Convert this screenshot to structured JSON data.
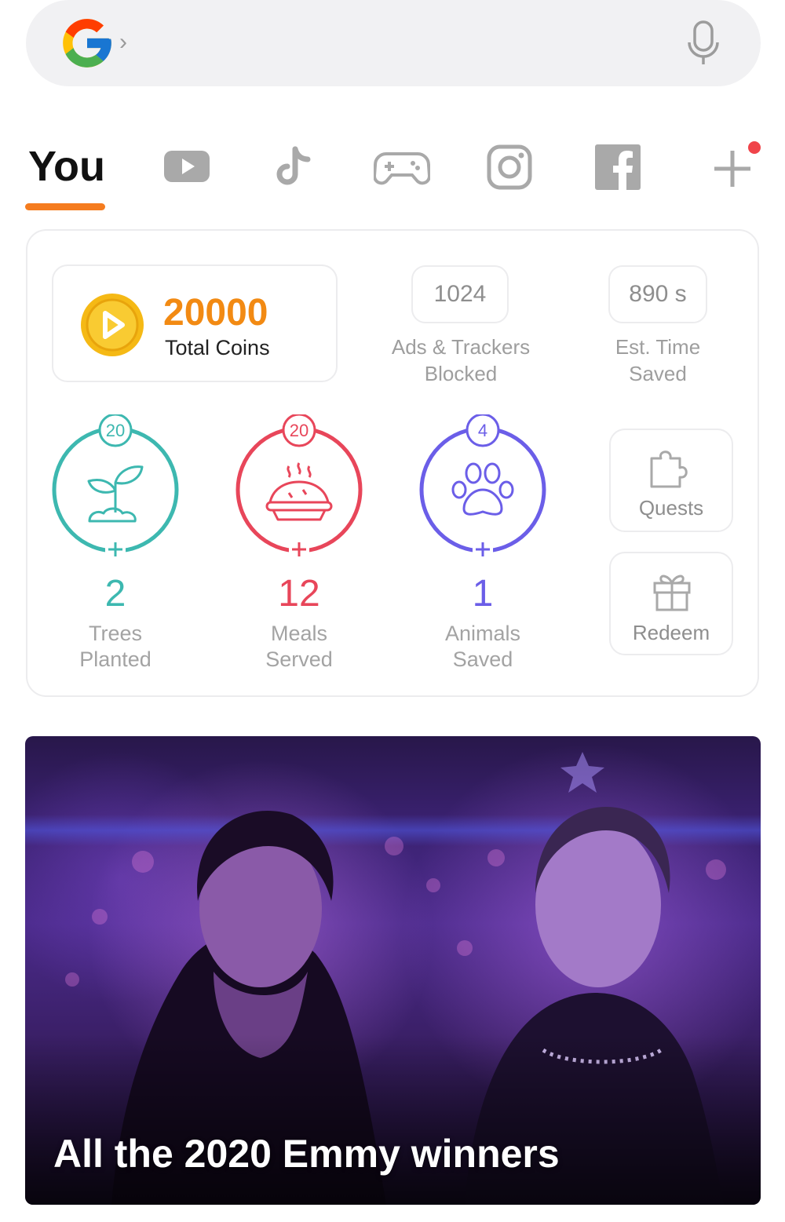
{
  "search": {
    "placeholder": ""
  },
  "tabs": {
    "you_label": "You",
    "icons": [
      "youtube-icon",
      "tiktok-icon",
      "gamepad-icon",
      "instagram-icon",
      "facebook-icon",
      "add-icon"
    ]
  },
  "stats": {
    "coins_value": "20000",
    "coins_label": "Total Coins",
    "ads_blocked_value": "1024",
    "ads_blocked_label_line1": "Ads & Trackers",
    "ads_blocked_label_line2": "Blocked",
    "time_saved_value": "890 s",
    "time_saved_label_line1": "Est. Time",
    "time_saved_label_line2": "Saved"
  },
  "impacts": [
    {
      "badge": "20",
      "count": "2",
      "line1": "Trees",
      "line2": "Planted",
      "color": "#3db8b0",
      "icon": "sprout-icon"
    },
    {
      "badge": "20",
      "count": "12",
      "line1": "Meals",
      "line2": "Served",
      "color": "#e8465a",
      "icon": "pie-icon"
    },
    {
      "badge": "4",
      "count": "1",
      "line1": "Animals",
      "line2": "Saved",
      "color": "#6b5ee8",
      "icon": "paw-icon"
    }
  ],
  "side_buttons": {
    "quests_label": "Quests",
    "redeem_label": "Redeem"
  },
  "news": {
    "title": "All the 2020 Emmy winners"
  },
  "colors": {
    "accent": "#f57c1f",
    "coin": "#f5b915",
    "notification": "#f0444a"
  }
}
